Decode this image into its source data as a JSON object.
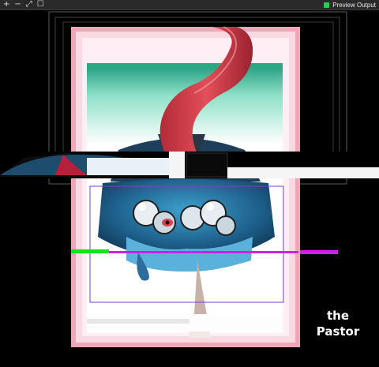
{
  "toolbar": {
    "icons": [
      "add-icon",
      "remove-icon",
      "fit-icon",
      "fullscreen-icon"
    ],
    "glyphs": [
      "+",
      "−",
      "⤢",
      "☐"
    ],
    "preview_label": "Preview Output",
    "preview_color": "#22d34a"
  },
  "artwork": {
    "caption_line1": "the",
    "caption_line2": "Pastor"
  },
  "colors": {
    "frame_pink": "#f2a4b9",
    "ribbon_red": "#d9424d",
    "figure_blue": "#2f7fb0",
    "glitch_green": "#15e315",
    "glitch_magenta": "#d51cf0"
  }
}
